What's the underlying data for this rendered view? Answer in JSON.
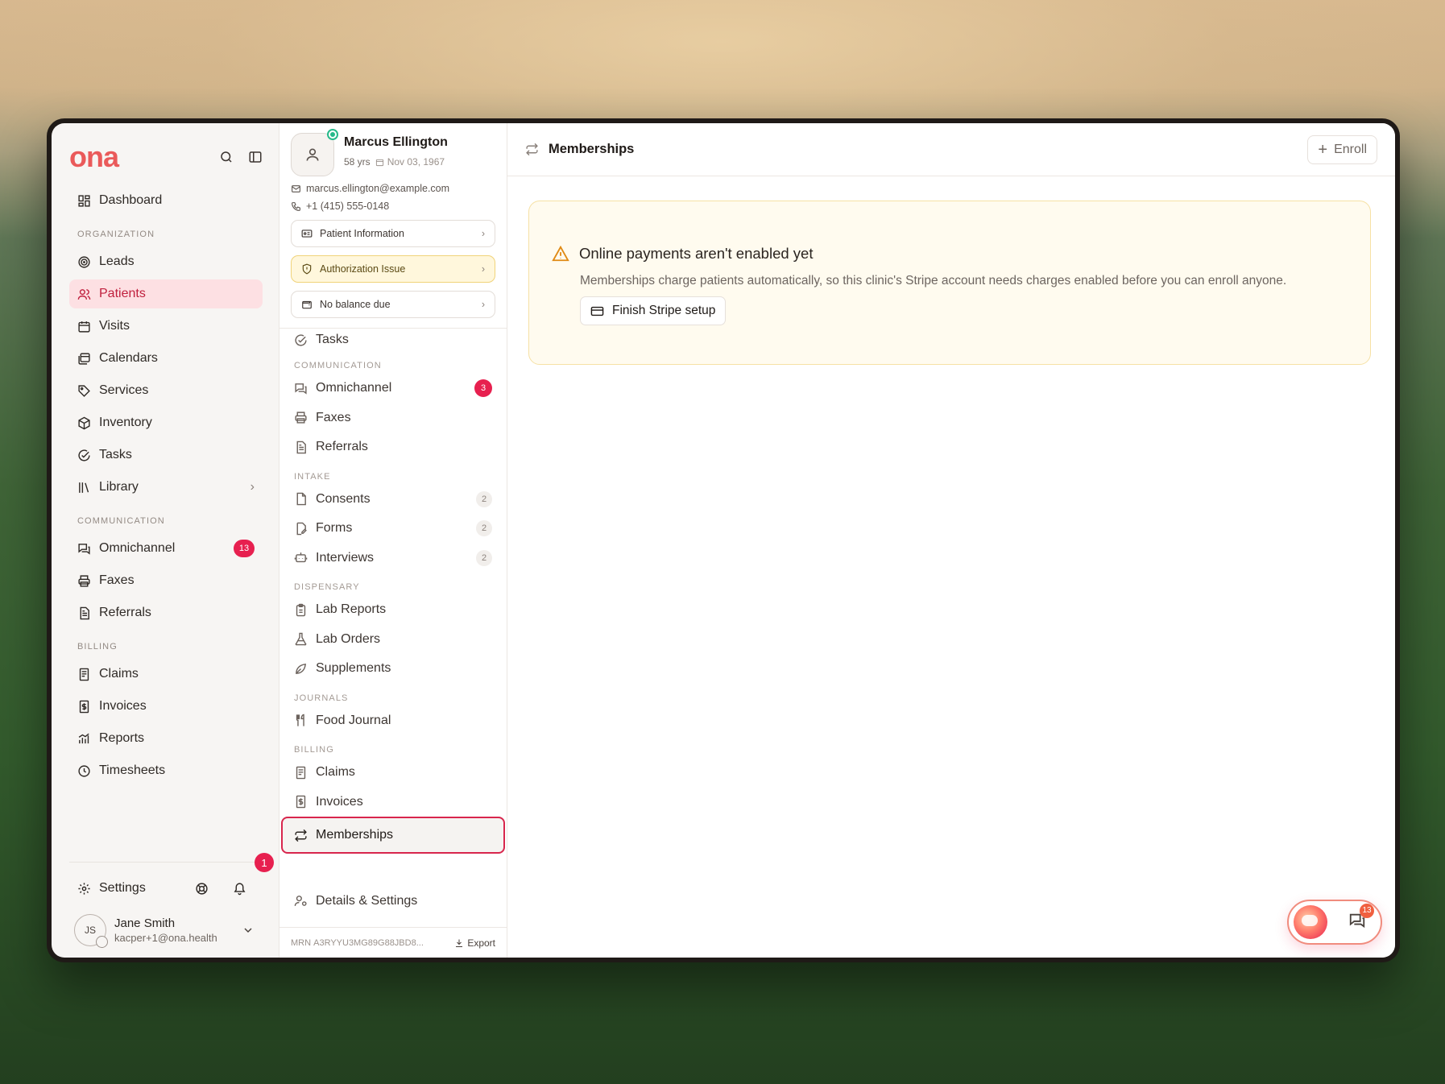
{
  "brand": {
    "logo": "ona"
  },
  "sidebar": {
    "dashboard": "Dashboard",
    "sections": {
      "organization": "ORGANIZATION",
      "communication": "COMMUNICATION",
      "billing": "BILLING"
    },
    "organization_items": [
      {
        "label": "Leads",
        "icon": "target-icon"
      },
      {
        "label": "Patients",
        "icon": "users-icon",
        "active": true
      },
      {
        "label": "Visits",
        "icon": "calendar-icon"
      },
      {
        "label": "Calendars",
        "icon": "calendars-icon"
      },
      {
        "label": "Services",
        "icon": "tag-icon"
      },
      {
        "label": "Inventory",
        "icon": "box-icon"
      },
      {
        "label": "Tasks",
        "icon": "check-circle-icon"
      },
      {
        "label": "Library",
        "icon": "library-icon"
      }
    ],
    "communication_items": [
      {
        "label": "Omnichannel",
        "badge": "13"
      },
      {
        "label": "Faxes"
      },
      {
        "label": "Referrals"
      }
    ],
    "billing_items": [
      {
        "label": "Claims"
      },
      {
        "label": "Invoices"
      },
      {
        "label": "Reports"
      },
      {
        "label": "Timesheets"
      }
    ],
    "notification_count": "1",
    "settings": "Settings",
    "user": {
      "initials": "JS",
      "name": "Jane Smith",
      "email": "kacper+1@ona.health"
    }
  },
  "patient": {
    "name": "Marcus Ellington",
    "age": "58 yrs",
    "dob": "Nov 03, 1967",
    "email": "marcus.ellington@example.com",
    "phone": "+1 (415) 555-0148",
    "cards": {
      "info": "Patient Information",
      "auth": "Authorization Issue",
      "balance": "No balance due"
    },
    "nav": {
      "tasks": "Tasks",
      "sections": {
        "communication": "COMMUNICATION",
        "intake": "INTAKE",
        "dispensary": "DISPENSARY",
        "journals": "JOURNALS",
        "billing": "BILLING"
      },
      "omnichannel": "Omnichannel",
      "omnichannel_badge": "3",
      "faxes": "Faxes",
      "referrals": "Referrals",
      "consents": "Consents",
      "consents_count": "2",
      "forms": "Forms",
      "forms_count": "2",
      "interviews": "Interviews",
      "interviews_count": "2",
      "lab_reports": "Lab Reports",
      "lab_orders": "Lab Orders",
      "supplements": "Supplements",
      "food_journal": "Food Journal",
      "claims": "Claims",
      "invoices": "Invoices",
      "memberships": "Memberships",
      "details": "Details & Settings"
    },
    "mrn_label": "MRN",
    "mrn": "A3RYYU3MG89G88JBD8...",
    "export": "Export"
  },
  "main": {
    "title": "Memberships",
    "enroll": "Enroll",
    "alert": {
      "title": "Online payments aren't enabled yet",
      "description": "Memberships charge patients automatically, so this clinic's Stripe account needs charges enabled before you can enroll anyone.",
      "button": "Finish Stripe setup"
    }
  },
  "chat": {
    "badge": "13"
  },
  "colors": {
    "accent": "#e7204f",
    "brand_red": "#ea5a5a",
    "brand_orange": "#f08c3c",
    "warn_bg": "#fffbef",
    "warn_border": "#f6e1a5"
  }
}
